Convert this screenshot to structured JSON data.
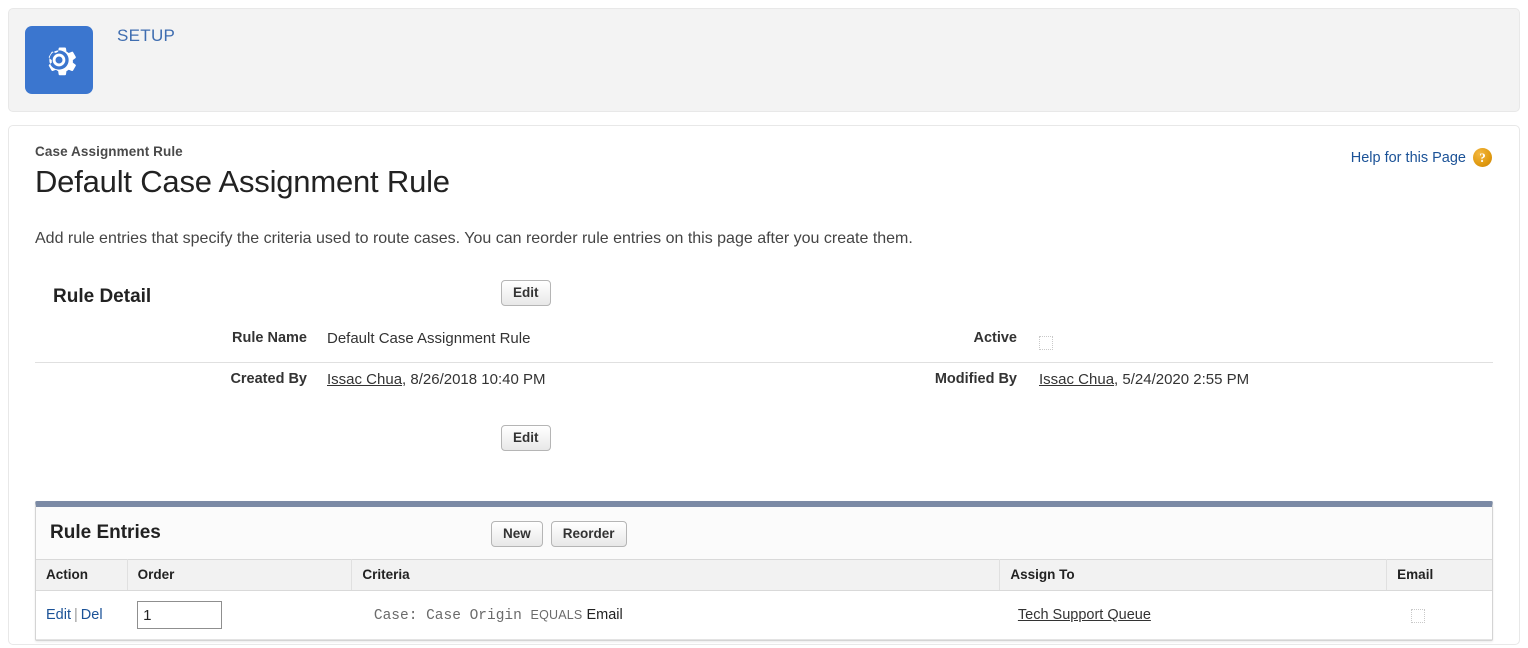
{
  "setup_header": {
    "icon": "gear-icon",
    "label": "SETUP",
    "icon_bg": "#3b76cf"
  },
  "help": {
    "label": "Help for this Page",
    "icon": "question-mark-icon",
    "icon_color": "#e09a10"
  },
  "header": {
    "eyebrow": "Case Assignment Rule",
    "title": "Default Case Assignment Rule",
    "description": "Add rule entries that specify the criteria used to route cases. You can reorder rule entries on this page after you create them."
  },
  "rule_detail": {
    "section_title": "Rule Detail",
    "edit_top_label": "Edit",
    "edit_bottom_label": "Edit",
    "fields": {
      "rule_name_label": "Rule Name",
      "rule_name_value": "Default Case Assignment Rule",
      "active_label": "Active",
      "active_checked": false,
      "created_by_label": "Created By",
      "created_by_user": "Issac Chua",
      "created_by_date": ", 8/26/2018 10:40 PM",
      "modified_by_label": "Modified By",
      "modified_by_user": "Issac Chua",
      "modified_by_date": ", 5/24/2020 2:55 PM"
    }
  },
  "rule_entries": {
    "section_title": "Rule Entries",
    "new_label": "New",
    "reorder_label": "Reorder",
    "columns": [
      "Action",
      "Order",
      "Criteria",
      "Assign To",
      "Email"
    ],
    "rows": [
      {
        "edit_label": "Edit",
        "separator": "|",
        "del_label": "Del",
        "order_value": "1",
        "criteria_field": "Case: Case Origin",
        "criteria_operator": "EQUALS",
        "criteria_value": "Email",
        "assign_to": "Tech Support Queue",
        "email_checked": false
      }
    ]
  }
}
